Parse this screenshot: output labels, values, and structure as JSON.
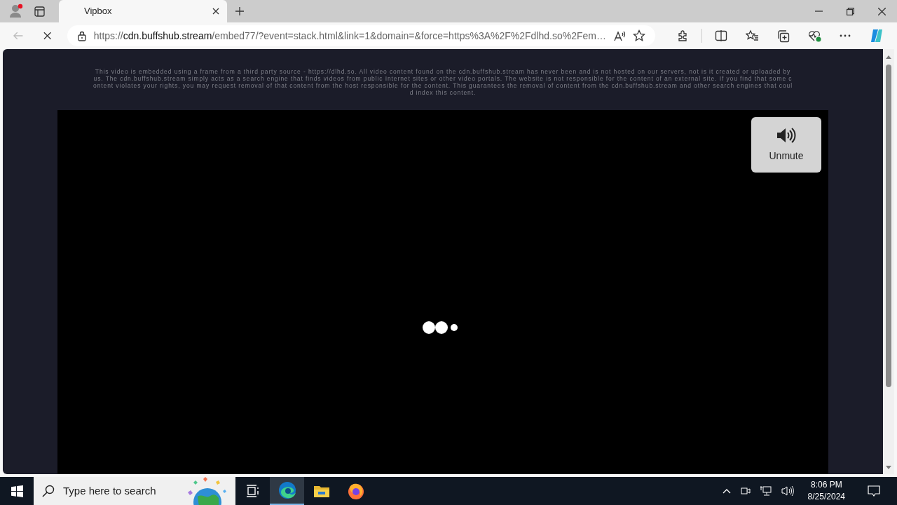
{
  "browser": {
    "tab": {
      "title": "Vipbox"
    },
    "loading": true,
    "url": {
      "scheme": "https://",
      "host": "cdn.buffshub.stream",
      "path": "/embed77/?event=stack.html&link=1&domain=&force=https%3A%2F%2Fdlhd.so%2Fem…"
    }
  },
  "page": {
    "disclaimer": "This video is embedded using a frame from a third party source - https://dlhd.so. All video content found on the cdn.buffshub.stream has never been and is not hosted on our servers, not is it created or uploaded by us. The cdn.buffshub.stream simply acts as a search engine that finds videos from public Internet sites or other video portals. The website is not responsible for the content of an external site. If you find that some content violates your rights, you may request removal of that content from the host responsible for the content. This guarantees the removal of content from the cdn.buffshub.stream and other search engines that could index this content.",
    "player": {
      "unmute_label": "Unmute"
    }
  },
  "taskbar": {
    "search_placeholder": "Type here to search",
    "apps": [
      {
        "kind": "taskview",
        "selected": false
      },
      {
        "kind": "edge",
        "selected": true
      },
      {
        "kind": "files",
        "selected": false
      },
      {
        "kind": "firefox",
        "selected": false
      }
    ],
    "clock": {
      "time": "8:06 PM",
      "date": "8/25/2024"
    }
  }
}
